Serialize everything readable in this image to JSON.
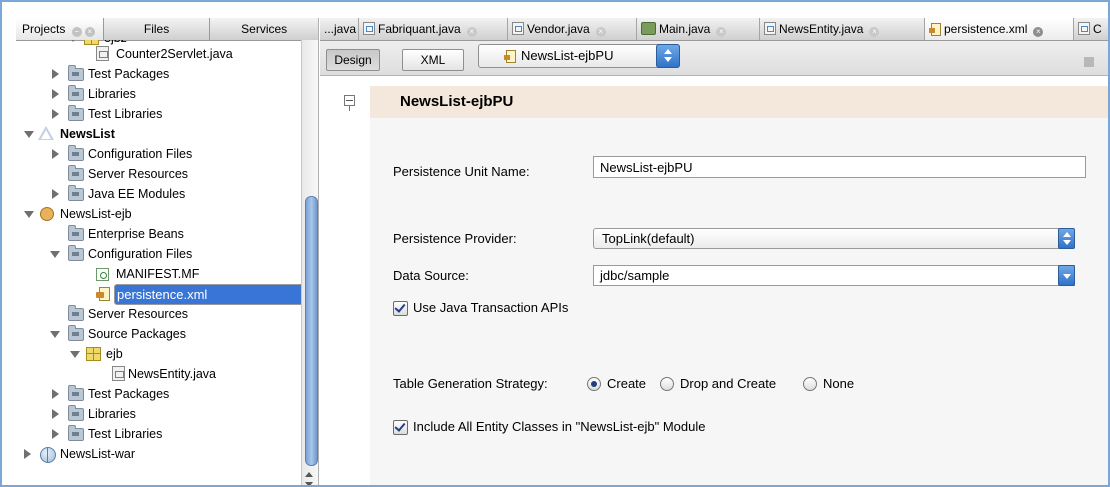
{
  "left_panel": {
    "tabs": [
      {
        "label": "Projects"
      },
      {
        "label": "Files"
      },
      {
        "label": "Services"
      }
    ],
    "tree": [
      {
        "label": "ejbz",
        "icon": "package-icon",
        "toggle": "expanded"
      },
      {
        "label": "Counter2Servlet.java",
        "icon": "java-file-icon"
      },
      {
        "label": "Test Packages",
        "icon": "folder-icon",
        "toggle": "collapsed"
      },
      {
        "label": "Libraries",
        "icon": "library-folder-icon",
        "toggle": "collapsed"
      },
      {
        "label": "Test Libraries",
        "icon": "library-folder-icon",
        "toggle": "collapsed"
      },
      {
        "label": "NewsList",
        "icon": "enterprise-project-icon",
        "toggle": "expanded"
      },
      {
        "label": "Configuration Files",
        "icon": "folder-icon",
        "toggle": "collapsed"
      },
      {
        "label": "Server Resources",
        "icon": "folder-icon"
      },
      {
        "label": "Java EE Modules",
        "icon": "folder-icon",
        "toggle": "collapsed"
      },
      {
        "label": "NewsList-ejb",
        "icon": "ejb-project-icon",
        "toggle": "expanded"
      },
      {
        "label": "Enterprise Beans",
        "icon": "folder-icon"
      },
      {
        "label": "Configuration Files",
        "icon": "folder-icon",
        "toggle": "expanded"
      },
      {
        "label": "MANIFEST.MF",
        "icon": "manifest-file-icon"
      },
      {
        "label": "persistence.xml",
        "icon": "persistence-xml-icon",
        "selected": true
      },
      {
        "label": "Server Resources",
        "icon": "folder-icon"
      },
      {
        "label": "Source Packages",
        "icon": "folder-icon",
        "toggle": "expanded"
      },
      {
        "label": "ejb",
        "icon": "package-icon",
        "toggle": "expanded"
      },
      {
        "label": "NewsEntity.java",
        "icon": "java-file-icon"
      },
      {
        "label": "Test Packages",
        "icon": "folder-icon",
        "toggle": "collapsed"
      },
      {
        "label": "Libraries",
        "icon": "library-folder-icon",
        "toggle": "collapsed"
      },
      {
        "label": "Test Libraries",
        "icon": "library-folder-icon",
        "toggle": "collapsed"
      },
      {
        "label": "NewsList-war",
        "icon": "web-project-icon",
        "toggle": "collapsed"
      }
    ]
  },
  "editor_tabs": [
    {
      "label": "...java"
    },
    {
      "label": "Fabriquant.java"
    },
    {
      "label": "Vendor.java"
    },
    {
      "label": "Main.java"
    },
    {
      "label": "NewsEntity.java"
    },
    {
      "label": "persistence.xml",
      "active": true
    },
    {
      "label": "C"
    }
  ],
  "toolbar": {
    "design_label": "Design",
    "xml_label": "XML",
    "persistence_unit": "NewsList-ejbPU"
  },
  "section": {
    "title": "NewsList-ejbPU"
  },
  "form": {
    "unit_name_label": "Persistence Unit Name:",
    "unit_name_value": "NewsList-ejbPU",
    "provider_label": "Persistence Provider:",
    "provider_value": "TopLink(default)",
    "data_source_label": "Data Source:",
    "data_source_value": "jdbc/sample",
    "use_jta_label": "Use Java Transaction APIs",
    "use_jta_checked": true,
    "table_gen_label": "Table Generation Strategy:",
    "table_gen_options": [
      {
        "label": "Create",
        "selected": true
      },
      {
        "label": "Drop and Create",
        "selected": false
      },
      {
        "label": "None",
        "selected": false
      }
    ],
    "include_all_label": "Include All Entity Classes in \"NewsList-ejb\" Module",
    "include_all_checked": true
  },
  "colors": {
    "selection": "#3875d7",
    "section_header": "#f4e8dc",
    "window_border": "#7ba7d6"
  }
}
